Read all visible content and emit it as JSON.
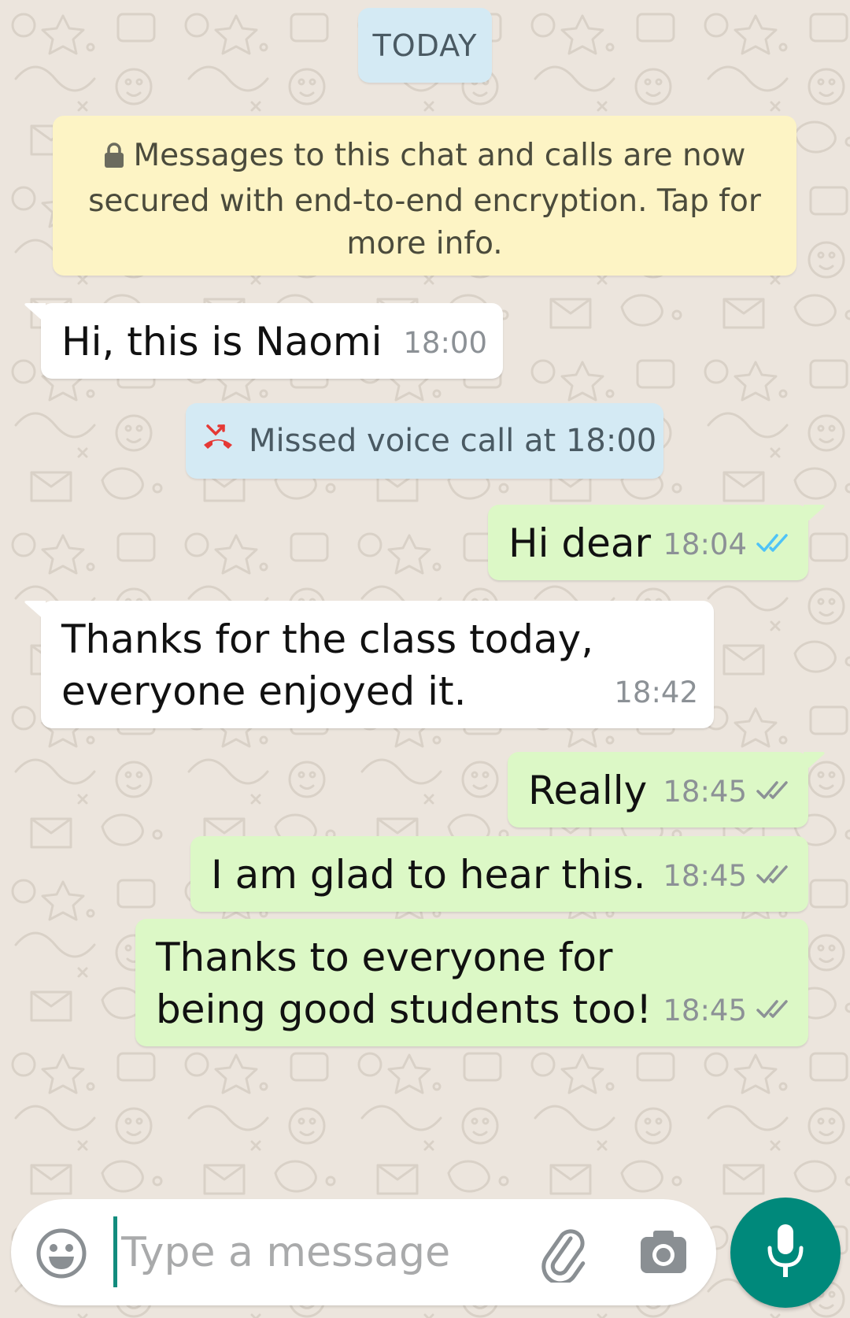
{
  "date_chip": "TODAY",
  "encryption_notice": "Messages to this chat and calls are now secured with end-to-end encryption. Tap for more info.",
  "missed_call": {
    "text": "Missed voice call at 18:00",
    "icon": "missed-call-icon",
    "icon_color": "#e53935"
  },
  "messages": [
    {
      "direction": "in",
      "text": "Hi, this is Naomi",
      "time": "18:00"
    },
    {
      "direction": "out",
      "text": "Hi dear",
      "time": "18:04",
      "status": "read"
    },
    {
      "direction": "in",
      "text": "Thanks for the class today, everyone enjoyed it.",
      "time": "18:42"
    },
    {
      "direction": "out",
      "text": "Really",
      "time": "18:45",
      "status": "delivered"
    },
    {
      "direction": "out",
      "text": "I am glad to hear this.",
      "time": "18:45",
      "status": "delivered"
    },
    {
      "direction": "out",
      "text": "Thanks to everyone for being good students too!",
      "time": "18:45",
      "status": "delivered"
    }
  ],
  "input_bar": {
    "placeholder": "Type a message",
    "value": ""
  },
  "colors": {
    "chat_background": "#ece5dd",
    "incoming_bubble": "#ffffff",
    "outgoing_bubble": "#dcf8c6",
    "read_receipt": "#4fc3f7",
    "delivered_receipt": "#8c9196",
    "mic_button": "#00897b",
    "notice_background": "#fdf4c5",
    "info_chip_background": "#d4eaf4"
  },
  "icons": [
    "lock-icon",
    "missed-call-icon",
    "double-check-icon",
    "emoji-icon",
    "paperclip-icon",
    "camera-icon",
    "mic-icon"
  ]
}
